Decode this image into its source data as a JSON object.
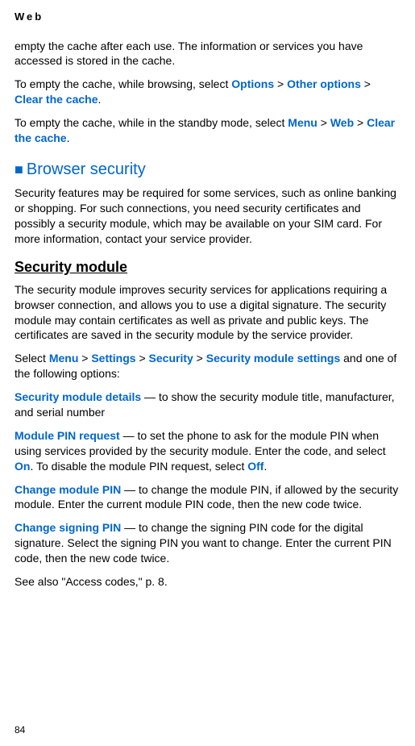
{
  "header": "Web",
  "para1_a": "empty the cache after each use. The information or services you have accessed is stored in the cache.",
  "para2_a": "To empty the cache, while browsing, select ",
  "para2_options": "Options",
  "para2_gt1": " > ",
  "para2_other": "Other options",
  "para2_gt2": " > ",
  "para2_clear": "Clear the cache",
  "para2_end": ".",
  "para3_a": "To empty the cache, while in the standby mode, select ",
  "para3_menu": "Menu",
  "para3_gt1": " > ",
  "para3_web": "Web",
  "para3_gt2": " > ",
  "para3_clear": "Clear the cache",
  "para3_end": ".",
  "section_square": "■",
  "section_title": "Browser security",
  "para4": "Security features may be required for some services, such as online banking or shopping. For such connections, you need security certificates and possibly a security module, which may be available on your SIM card. For more information, contact your service provider.",
  "subsection": "Security module",
  "para5": "The security module improves security services for applications requiring a browser connection, and allows you to use a digital signature. The security module may contain certificates as well as private and public keys. The certificates are saved in the security module by the service provider.",
  "para6_a": "Select ",
  "para6_menu": "Menu",
  "para6_gt1": " > ",
  "para6_settings": "Settings",
  "para6_gt2": " > ",
  "para6_security": "Security",
  "para6_gt3": " > ",
  "para6_secmod": "Security module settings",
  "para6_end": " and one of the following options:",
  "para7_link": "Security module details",
  "para7_text": " — to show the security module title, manufacturer, and serial number",
  "para8_link": "Module PIN request",
  "para8_text_a": " — to set the phone to ask for the module PIN when using services provided by the security module. Enter the code, and select ",
  "para8_on": "On",
  "para8_text_b": ". To disable the module PIN request, select ",
  "para8_off": "Off",
  "para8_text_c": ".",
  "para9_link": "Change module PIN",
  "para9_text": " — to change the module PIN, if allowed by the security module. Enter the current module PIN code, then the new code twice.",
  "para10_link": "Change signing PIN",
  "para10_text": " — to change the signing PIN code for the digital signature. Select the signing PIN you want to change. Enter the current PIN code, then the new code twice.",
  "para11": "See also \"Access codes,\" p. 8.",
  "page_number": "84"
}
